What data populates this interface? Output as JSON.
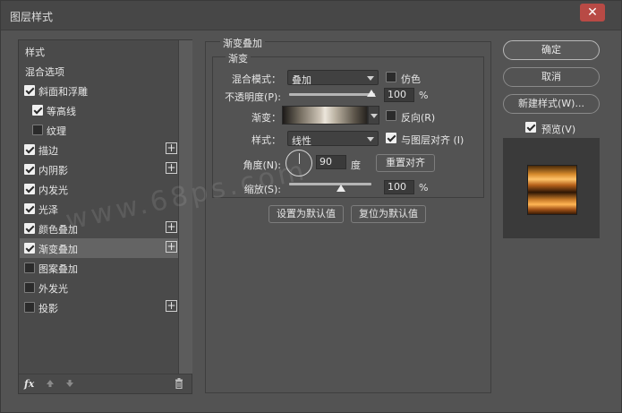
{
  "window": {
    "title": "图层样式",
    "close": "✕"
  },
  "sidebar": {
    "items": [
      {
        "label": "样式",
        "checkbox": false,
        "plus": false
      },
      {
        "label": "混合选项",
        "checkbox": false,
        "plus": false
      },
      {
        "label": "斜面和浮雕",
        "checkbox": true,
        "checked": true,
        "plus": false
      },
      {
        "label": "等高线",
        "checkbox": true,
        "checked": true,
        "indent": true,
        "plus": false
      },
      {
        "label": "纹理",
        "checkbox": true,
        "checked": false,
        "indent": true,
        "plus": false
      },
      {
        "label": "描边",
        "checkbox": true,
        "checked": true,
        "plus": true
      },
      {
        "label": "内阴影",
        "checkbox": true,
        "checked": true,
        "plus": true
      },
      {
        "label": "内发光",
        "checkbox": true,
        "checked": true,
        "plus": false
      },
      {
        "label": "光泽",
        "checkbox": true,
        "checked": true,
        "plus": false
      },
      {
        "label": "颜色叠加",
        "checkbox": true,
        "checked": true,
        "plus": true
      },
      {
        "label": "渐变叠加",
        "checkbox": true,
        "checked": true,
        "plus": true,
        "selected": true
      },
      {
        "label": "图案叠加",
        "checkbox": true,
        "checked": false,
        "plus": false
      },
      {
        "label": "外发光",
        "checkbox": true,
        "checked": false,
        "plus": false
      },
      {
        "label": "投影",
        "checkbox": true,
        "checked": false,
        "plus": true
      }
    ],
    "footer": {
      "fx": "fx"
    }
  },
  "panel": {
    "title": "渐变叠加",
    "subtitle": "渐变",
    "blend_mode_label": "混合模式：",
    "blend_mode_value": "叠加",
    "dither_label": "仿色",
    "opacity_label": "不透明度(P):",
    "opacity_value": "100",
    "opacity_level": 1.0,
    "percent": "%",
    "gradient_label": "渐变：",
    "reverse_label": "反向(R)",
    "style_label": "样式：",
    "style_value": "线性",
    "align_label": "与图层对齐 (I)",
    "angle_label": "角度(N):",
    "angle_value": "90",
    "angle_unit": "度",
    "reset_align_button": "重置对齐",
    "scale_label": "缩放(S):",
    "scale_value": "100",
    "scale_level": 0.5,
    "set_default_button": "设置为默认值",
    "reset_default_button": "复位为默认值"
  },
  "right": {
    "ok": "确定",
    "cancel": "取消",
    "new_style": "新建样式(W)...",
    "preview_label": "预览(V)"
  },
  "watermark": "www.68ps.com"
}
